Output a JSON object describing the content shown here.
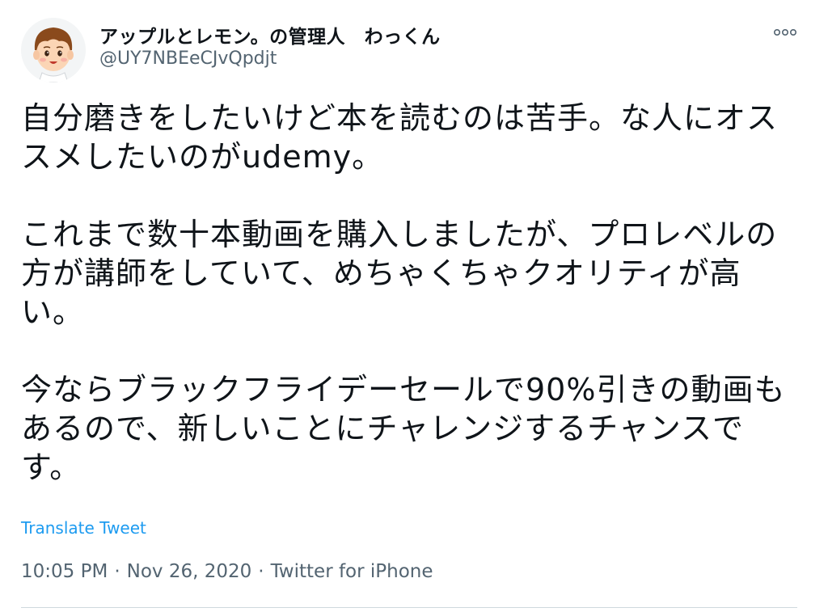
{
  "tweet": {
    "author": {
      "display_name": "アップルとレモン。の管理人　わっくん",
      "handle": "@UY7NBEeCJvQpdjt",
      "avatar_icon": "cartoon-boy-avatar"
    },
    "more_icon": "more-dots-icon",
    "text": "自分磨きをしたいけど本を読むのは苦手。な人にオススメしたいのがudemy。\n\nこれまで数十本動画を購入しましたが、プロレベルの方が講師をしていて、めちゃくちゃクオリティが高い。\n\n今ならブラックフライデーセールで90%引きの動画もあるので、新しいことにチャレンジするチャンスです。",
    "translate_label": "Translate Tweet",
    "time": "10:05 PM",
    "date": "Nov 26, 2020",
    "source": "Twitter for iPhone",
    "separator": "·"
  },
  "colors": {
    "text": "#0f1419",
    "secondary": "#536471",
    "link": "#1d9bf0",
    "divider": "#cfd9de"
  }
}
